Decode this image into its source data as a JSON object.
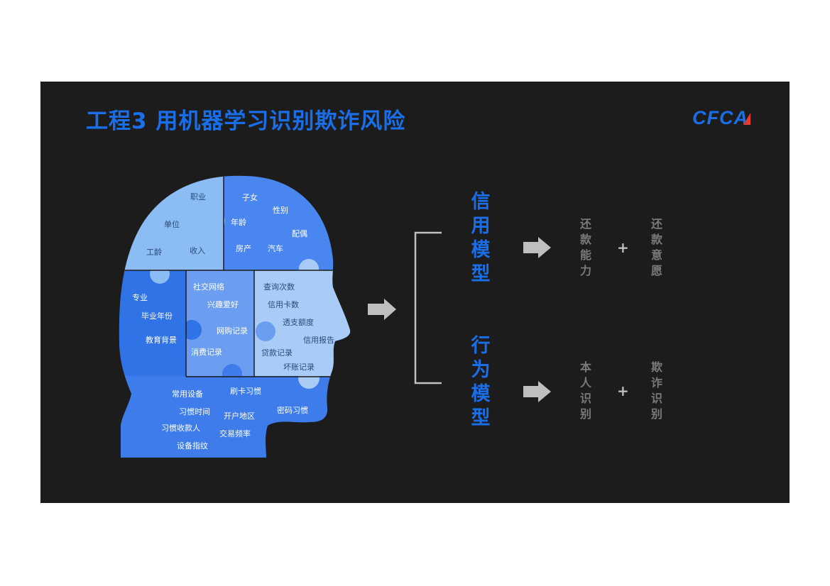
{
  "title": "工程3 用机器学习识别欺诈风险",
  "logo": "CFCA",
  "colors": {
    "accent": "#1a6ee8",
    "background": "#1c1c1c",
    "arrow": "#bfbfbf",
    "muted_text": "#7a7a7a"
  },
  "head_pieces": {
    "top_left": [
      "职业",
      "单位",
      "工龄",
      "收入"
    ],
    "top_right": [
      "子女",
      "性别",
      "年龄",
      "配偶",
      "房产",
      "汽车"
    ],
    "mid_left": [
      "专业",
      "毕业年份",
      "教育背景"
    ],
    "mid_center": [
      "社交网络",
      "兴趣爱好",
      "网购记录",
      "消费记录"
    ],
    "mid_right": [
      "查询次数",
      "信用卡数",
      "透支额度",
      "信用报告",
      "贷款记录",
      "坏账记录"
    ],
    "bottom": [
      "常用设备",
      "刷卡习惯",
      "习惯时间",
      "开户地区",
      "密码习惯",
      "习惯收款人",
      "交易频率",
      "设备指纹"
    ]
  },
  "models": [
    {
      "name": "信用模型",
      "outputs": [
        "还款能力",
        "还款意愿"
      ],
      "plus": "+"
    },
    {
      "name": "行为模型",
      "outputs": [
        "本人识别",
        "欺诈识别"
      ],
      "plus": "+"
    }
  ]
}
